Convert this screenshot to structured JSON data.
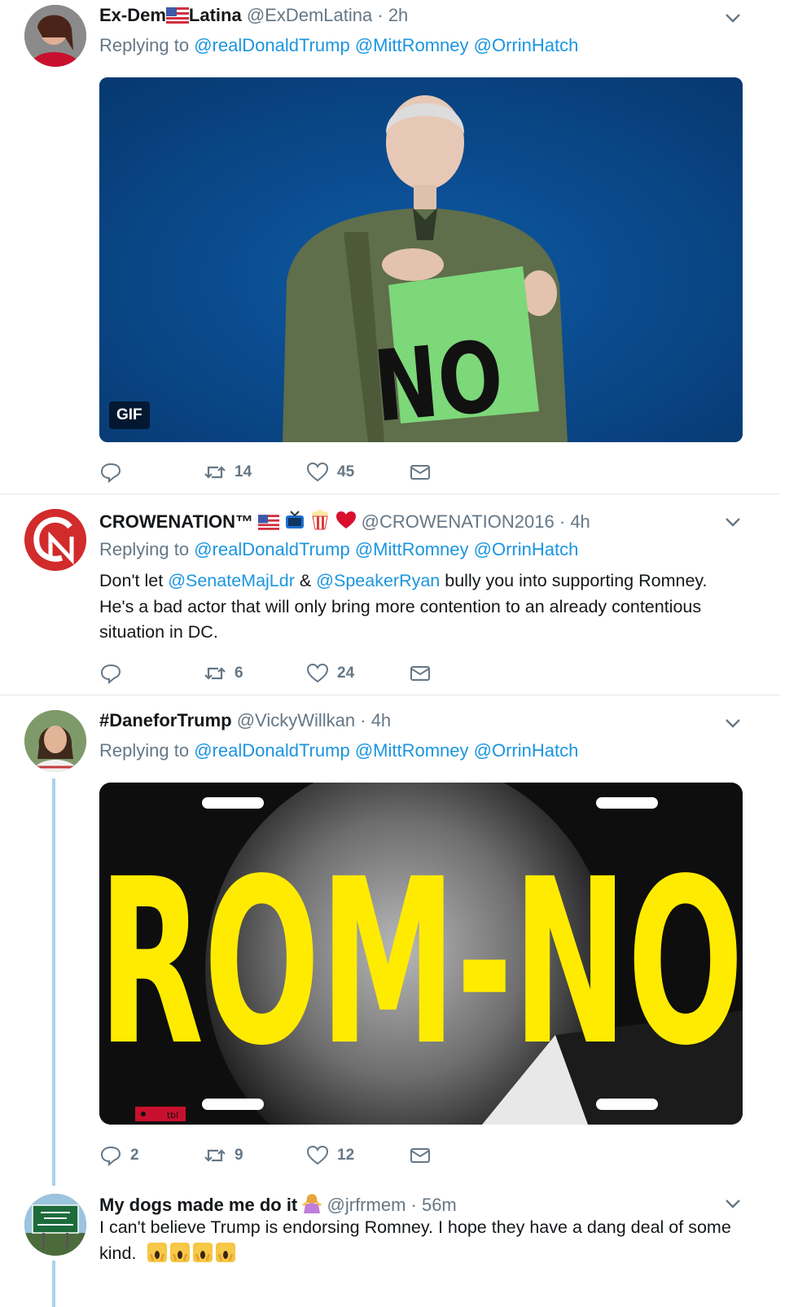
{
  "tweets": [
    {
      "name_a": "Ex-Dem",
      "name_b": "Latina",
      "handle": "@ExDemLatina",
      "time": "· 2h",
      "replying_prefix": "Replying to",
      "mentions": [
        "@realDonaldTrump",
        "@MittRomney",
        "@OrrinHatch"
      ],
      "media_badge": "GIF",
      "media_sign": "NO",
      "counts": {
        "reply": "",
        "retweet": "14",
        "like": "45"
      }
    },
    {
      "name": "CROWENATION™",
      "handle": "@CROWENATION2016",
      "time": "· 4h",
      "replying_prefix": "Replying to",
      "mentions": [
        "@realDonaldTrump",
        "@MittRomney",
        "@OrrinHatch"
      ],
      "text_parts": [
        "Don't let ",
        "@SenateMajLdr",
        " & ",
        "@SpeakerRyan",
        " bully you into supporting Romney. He's a bad actor that will only bring more contention to an already contentious situation in DC."
      ],
      "counts": {
        "reply": "",
        "retweet": "6",
        "like": "24"
      }
    },
    {
      "name": "#DaneforTrump",
      "handle": "@VickyWillkan",
      "time": "· 4h",
      "replying_prefix": "Replying to",
      "mentions": [
        "@realDonaldTrump",
        "@MittRomney",
        "@OrrinHatch"
      ],
      "media_text": "ROM-NO",
      "media_tag": "tbl",
      "counts": {
        "reply": "2",
        "retweet": "9",
        "like": "12"
      }
    },
    {
      "name": "My dogs made me do it",
      "handle": "@jrfrmem",
      "time": "· 56m",
      "text": "I can't believe Trump is endorsing Romney.  I hope they have a dang deal of some kind."
    }
  ],
  "colors": {
    "link": "#1b95e0",
    "muted": "#657786",
    "gif_bg": "#0a4a8c",
    "sign": "#7dd87a",
    "plate_text": "#ffeb00",
    "thread": "#a9d2ef"
  },
  "icons": [
    "reply-icon",
    "retweet-icon",
    "like-icon",
    "dm-icon",
    "chevron-down-icon"
  ]
}
